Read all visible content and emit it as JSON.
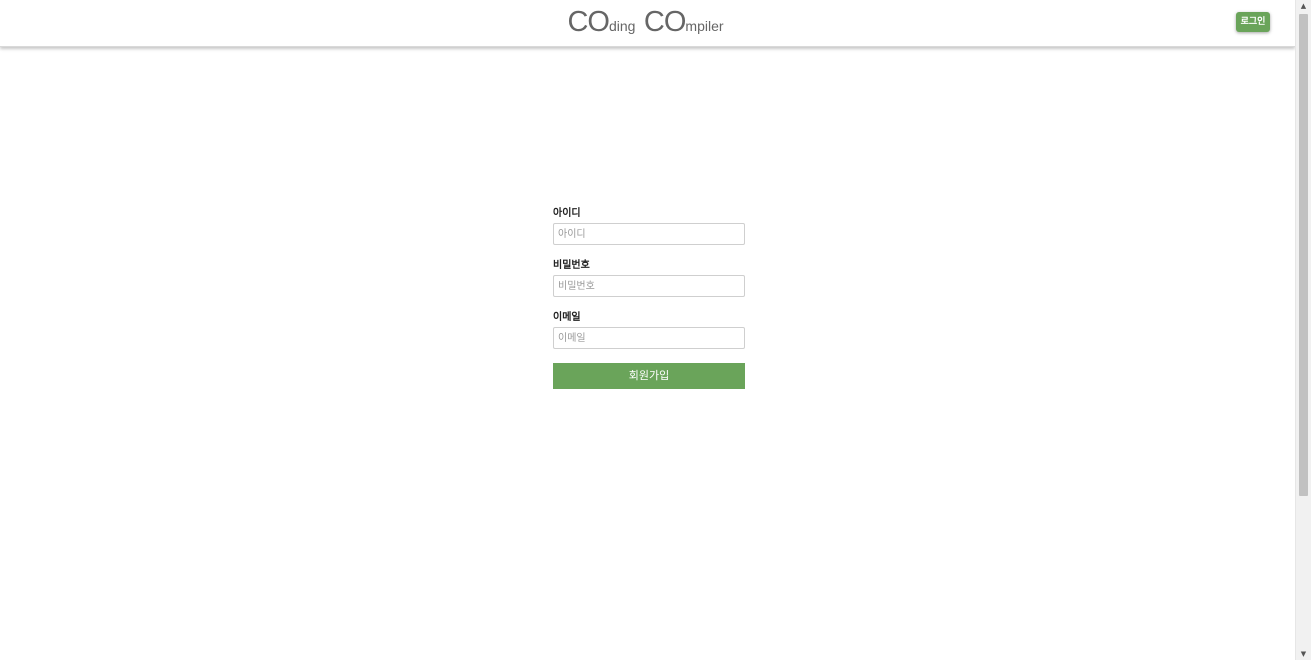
{
  "header": {
    "logo": {
      "c1": "C",
      "o1": "O",
      "rest1": "ding",
      "c2": "C",
      "o2": "O",
      "rest2": "mpiler"
    },
    "login_label": "로그인"
  },
  "form": {
    "username": {
      "label": "아이디",
      "placeholder": "아이디",
      "value": ""
    },
    "password": {
      "label": "비밀번호",
      "placeholder": "비밀번호",
      "value": ""
    },
    "email": {
      "label": "이메일",
      "placeholder": "이메일",
      "value": ""
    },
    "submit_label": "회원가입"
  },
  "scrollbar": {
    "up_icon": "▲",
    "down_icon": "▼"
  },
  "colors": {
    "accent": "#6aa45a",
    "logo_text": "#666666"
  }
}
